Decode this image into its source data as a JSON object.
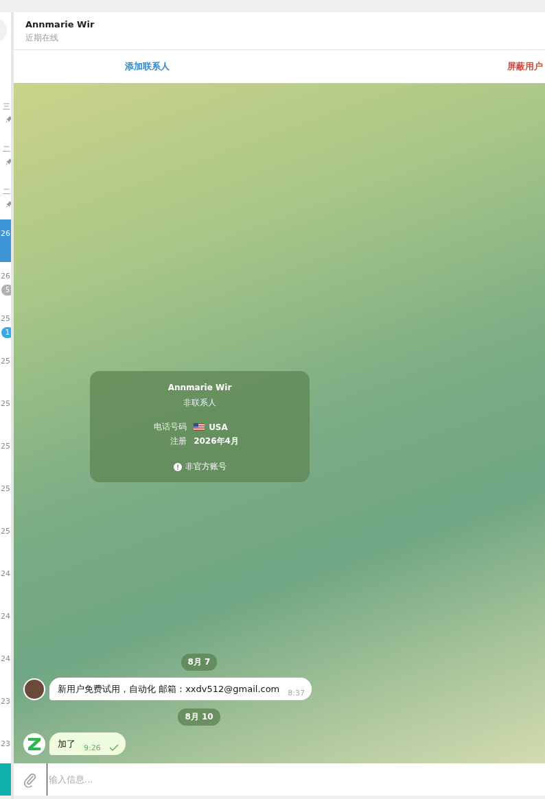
{
  "chat_list": [
    {
      "time": "三",
      "pinned": true,
      "selected": false
    },
    {
      "time": "二",
      "pinned": true,
      "selected": false
    },
    {
      "time": "二",
      "pinned": true,
      "selected": false
    },
    {
      "time": "26",
      "pinned": false,
      "selected": true
    },
    {
      "time": "26",
      "pinned": false,
      "selected": false,
      "badge": "5",
      "muted": true
    },
    {
      "time": "25",
      "pinned": false,
      "selected": false,
      "badge": "1",
      "muted": false
    },
    {
      "time": "25",
      "pinned": false,
      "selected": false
    },
    {
      "time": "25",
      "pinned": false,
      "selected": false
    },
    {
      "time": "25",
      "pinned": false,
      "selected": false
    },
    {
      "time": "25",
      "pinned": false,
      "selected": false
    },
    {
      "time": "25",
      "pinned": false,
      "selected": false
    },
    {
      "time": "24",
      "pinned": false,
      "selected": false
    },
    {
      "time": "24",
      "pinned": false,
      "selected": false
    },
    {
      "time": "24",
      "pinned": false,
      "selected": false
    },
    {
      "time": "23",
      "pinned": false,
      "selected": false
    },
    {
      "time": "23",
      "pinned": false,
      "selected": false
    }
  ],
  "header": {
    "name": "Annmarie Wir",
    "status": "近期在线"
  },
  "actions": [
    {
      "label": "添加联系人",
      "kind": "add"
    },
    {
      "label": "屏蔽用户",
      "kind": "block"
    }
  ],
  "info_card": {
    "name": "Annmarie Wir",
    "subtitle": "非联系人",
    "rows": [
      {
        "label": "电话号码",
        "value": "USA",
        "kind": "phone"
      },
      {
        "label": "注册",
        "value": "2026年4月",
        "kind": "date"
      }
    ],
    "notice": "非官方账号"
  },
  "messages": [
    {
      "kind": "date",
      "text": "8月 7"
    },
    {
      "kind": "message",
      "outgoing": false,
      "text": "新用户免费试用，自动化 邮箱：xxdv512@gmail.com",
      "time": "8:37"
    },
    {
      "kind": "date",
      "text": "8月 10"
    },
    {
      "kind": "message",
      "outgoing": true,
      "text": "加了",
      "time": "9:26",
      "read": true
    }
  ],
  "composer": {
    "placeholder": "输入信息..."
  }
}
